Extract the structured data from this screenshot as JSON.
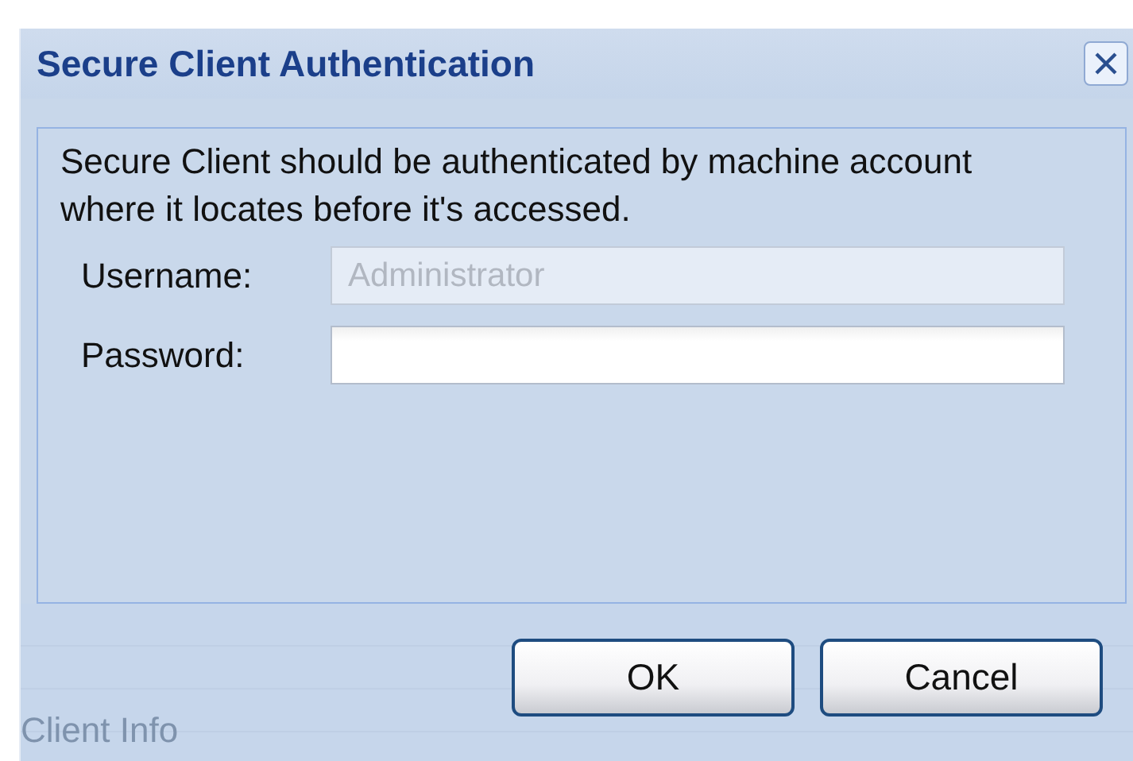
{
  "dialog": {
    "title": "Secure Client Authentication",
    "message": "Secure Client should be authenticated by machine account where it locates before it's accessed.",
    "fields": [
      {
        "label": "Username:",
        "value": "Administrator",
        "disabled": true
      },
      {
        "label": "Password:",
        "disabled": false
      }
    ],
    "buttons": [
      "OK",
      "Cancel"
    ],
    "background_text": "Client Info"
  }
}
